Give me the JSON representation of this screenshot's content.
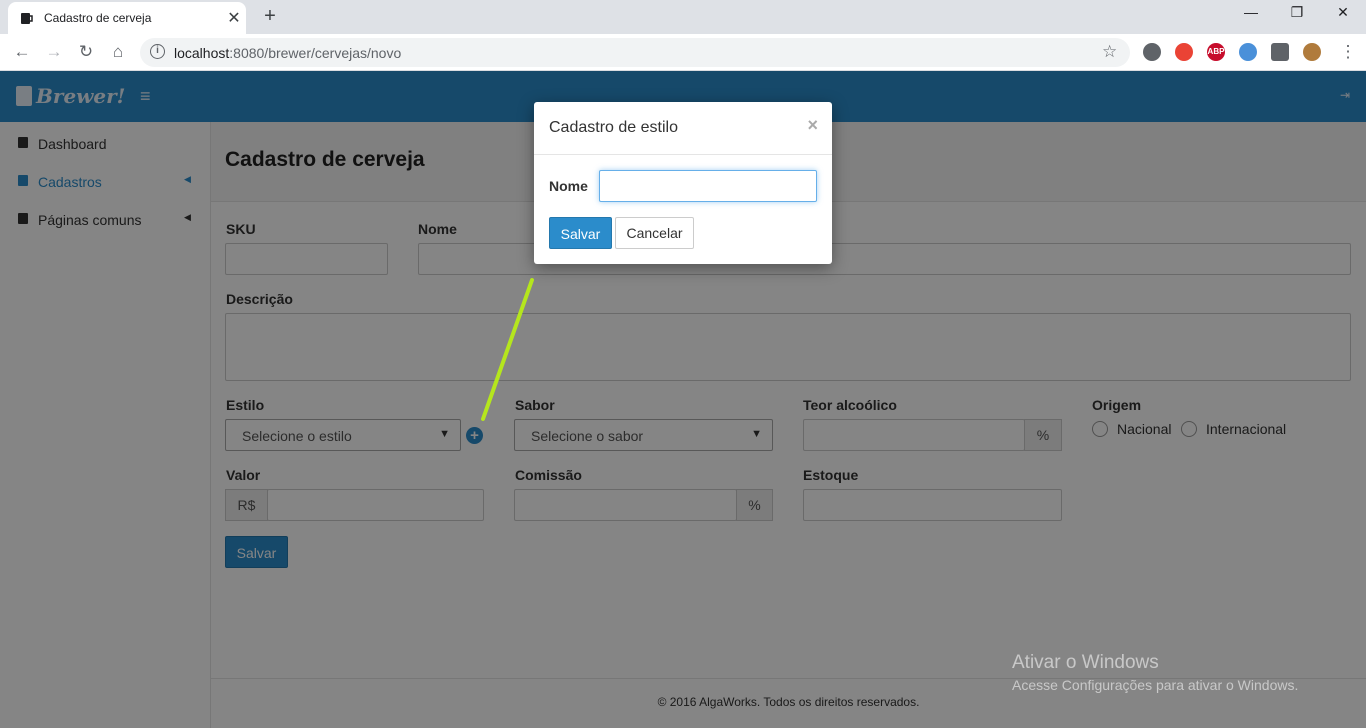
{
  "browser": {
    "tab_title": "Cadastro de cerveja",
    "tab_close": "✕",
    "new_tab": "+",
    "window_controls": [
      "—",
      "❐",
      "✕"
    ],
    "url_host": "localhost",
    "url_path": ":8080/brewer/cervejas/novo",
    "nav_icons": [
      "back-icon",
      "forward-icon",
      "reload-icon",
      "home-icon"
    ],
    "extensions": [
      {
        "name": "screenshot-ext-icon",
        "text": "",
        "color": "#5f6368"
      },
      {
        "name": "cast-ext-icon",
        "text": "",
        "color": "#ea4335"
      },
      {
        "name": "adblock-icon",
        "text": "ABP",
        "color": "#c70d2c"
      },
      {
        "name": "mascot-ext-icon",
        "text": "",
        "color": "#4a90d9"
      },
      {
        "name": "puzzle-icon",
        "text": "",
        "color": "#5f6368"
      },
      {
        "name": "profile-avatar",
        "text": "",
        "color": "#b07b3c"
      }
    ]
  },
  "app": {
    "brand": "Brewer!",
    "accent": "#2b8ccb"
  },
  "sidebar": {
    "items": [
      {
        "label": "Dashboard",
        "icon": "home-icon",
        "caret": false,
        "active": false
      },
      {
        "label": "Cadastros",
        "icon": "file-icon",
        "caret": true,
        "active": true
      },
      {
        "label": "Páginas comuns",
        "icon": "file-icon",
        "caret": true,
        "active": false
      }
    ]
  },
  "page": {
    "title": "Cadastro de cerveja",
    "labels": {
      "sku": "SKU",
      "nome": "Nome",
      "descricao": "Descrição",
      "estilo": "Estilo",
      "sabor": "Sabor",
      "teor": "Teor alcoólico",
      "origem": "Origem",
      "valor": "Valor",
      "comissao": "Comissão",
      "estoque": "Estoque"
    },
    "estilo_select": "Selecione o estilo",
    "sabor_select": "Selecione o sabor",
    "percent": "%",
    "currency": "R$",
    "origem_options": [
      "Nacional",
      "Internacional"
    ],
    "save_button": "Salvar",
    "footer": "© 2016 AlgaWorks. Todos os direitos reservados."
  },
  "modal": {
    "title": "Cadastro de estilo",
    "close": "×",
    "nome_label": "Nome",
    "nome_value": "",
    "save_button": "Salvar",
    "cancel_button": "Cancelar"
  },
  "watermark": {
    "title": "Ativar o Windows",
    "subtitle": "Acesse Configurações para ativar o Windows."
  }
}
